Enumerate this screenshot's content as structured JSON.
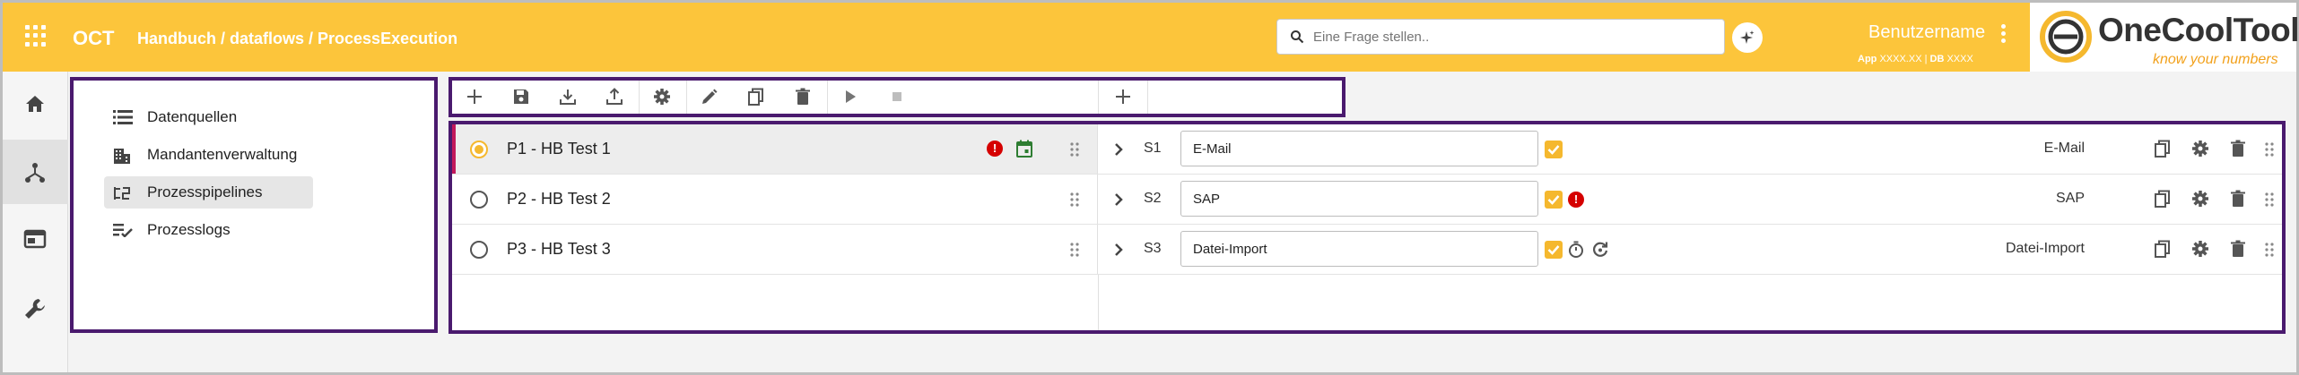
{
  "header": {
    "app_name": "OCT",
    "breadcrumb": "Handbuch / dataflows / ProcessExecution",
    "search_placeholder": "Eine Frage stellen..",
    "username": "Benutzername",
    "app_label": "App",
    "app_value": "XXXX.XX",
    "db_label": "DB",
    "db_value": "XXXX",
    "logo_word": "OneCoolTool",
    "logo_tagline": "know your numbers"
  },
  "rail": {
    "items": [
      {
        "icon": "home-icon"
      },
      {
        "icon": "hierarchy-icon",
        "active": true
      },
      {
        "icon": "window-icon"
      },
      {
        "icon": "wrench-icon"
      }
    ]
  },
  "nav": {
    "items": [
      {
        "label": "Datenquellen",
        "icon": "list-icon"
      },
      {
        "label": "Mandantenverwaltung",
        "icon": "building-icon"
      },
      {
        "label": "Prozesspipelines",
        "icon": "pipeline-icon",
        "active": true
      },
      {
        "label": "Prozesslogs",
        "icon": "checklist-icon"
      }
    ]
  },
  "toolbar": {
    "buttons": [
      "add-icon",
      "save-icon",
      "download-icon",
      "upload-icon",
      "settings-icon",
      "edit-icon",
      "copy-icon",
      "delete-icon",
      "play-icon",
      "stop-icon",
      "add-icon"
    ]
  },
  "pipelines": [
    {
      "name": "P1 - HB Test 1",
      "selected": true,
      "error": true,
      "scheduled": true,
      "step_code": "S1",
      "step_value": "E-Mail",
      "step_type": "E-Mail",
      "step_error": false,
      "step_timer": false
    },
    {
      "name": "P2 - HB Test 2",
      "selected": false,
      "error": false,
      "scheduled": false,
      "step_code": "S2",
      "step_value": "SAP",
      "step_type": "SAP",
      "step_error": true,
      "step_timer": false
    },
    {
      "name": "P3 - HB Test 3",
      "selected": false,
      "error": false,
      "scheduled": false,
      "step_code": "S3",
      "step_value": "Datei-Import",
      "step_type": "Datei-Import",
      "step_error": false,
      "step_timer": true
    }
  ],
  "colors": {
    "header": "#fcc53b",
    "frame": "#4a1a6e",
    "accent": "#f5b82e",
    "error": "#d50000",
    "selected_marker": "#c2185b",
    "calendar": "#2e7d32"
  }
}
